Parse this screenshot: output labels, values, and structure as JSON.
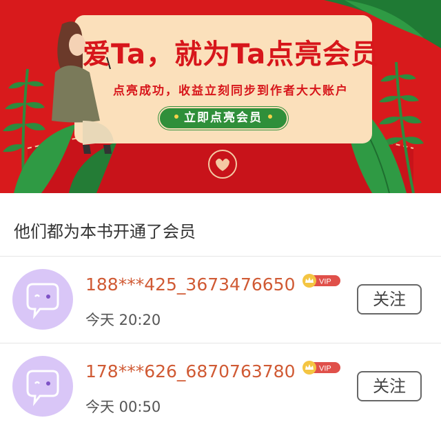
{
  "banner": {
    "headline": "爱Ta，就为Ta点亮会员",
    "subtitle": "点亮成功，收益立刻同步到作者大大账户",
    "cta_label": "立即点亮会员",
    "background_color": "#d81a1c",
    "card_color": "#fbe0bb",
    "cta_color": "#2f8f3a"
  },
  "section": {
    "title": "他们都为本书开通了会员"
  },
  "members": [
    {
      "username": "188***425_3673476650",
      "badge": "VIP",
      "time": "今天 20:20",
      "follow_label": "关注",
      "avatar_icon": "chat-bubble-face-icon"
    },
    {
      "username": "178***626_6870763780",
      "badge": "VIP",
      "time": "今天 00:50",
      "follow_label": "关注",
      "avatar_icon": "chat-bubble-face-icon"
    }
  ],
  "colors": {
    "username": "#d05a34",
    "vip_badge": "#e0504a",
    "avatar_bg": "#d9c6f7"
  }
}
